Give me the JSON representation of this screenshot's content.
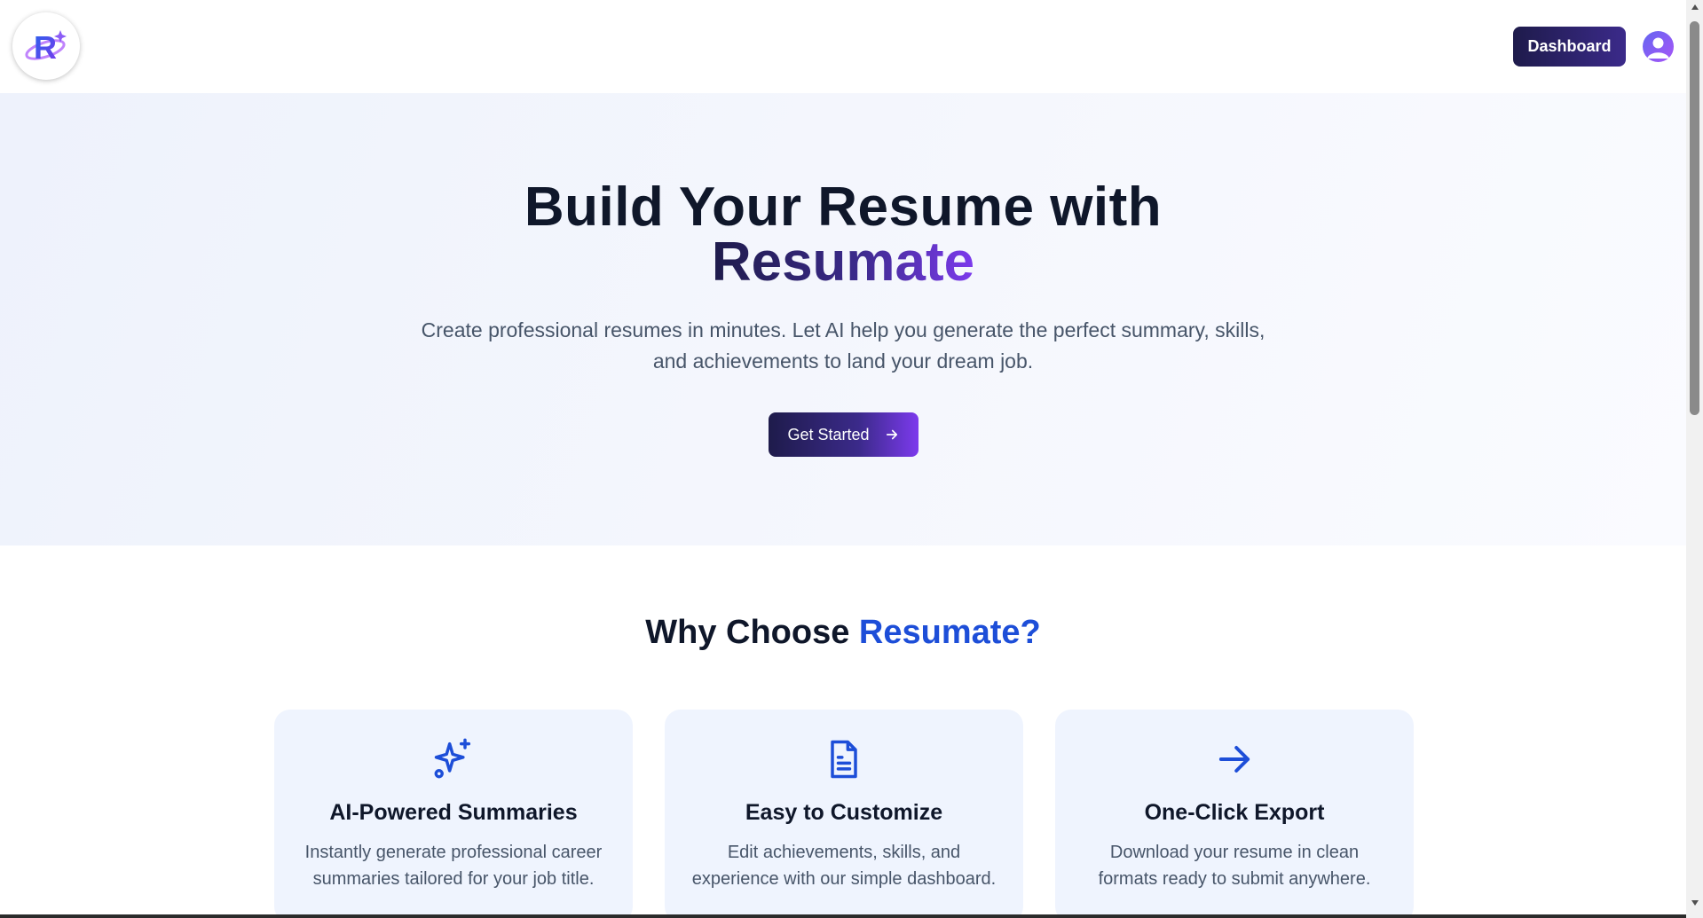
{
  "header": {
    "logo_letter": "R",
    "dashboard_label": "Dashboard",
    "avatar_icon": "user-avatar-icon"
  },
  "hero": {
    "title": "Build Your Resume with",
    "brand": "Resumate",
    "subtitle": "Create professional resumes in minutes. Let AI help you generate the perfect summary, skills, and achievements to land your dream job.",
    "cta_label": "Get Started",
    "cta_icon": "arrow-right-icon"
  },
  "why": {
    "title_prefix": "Why Choose",
    "title_accent": "Resumate?"
  },
  "features": [
    {
      "icon": "sparkles-icon",
      "title": "AI-Powered Summaries",
      "description": "Instantly generate professional career summaries tailored for your job title."
    },
    {
      "icon": "document-icon",
      "title": "Easy to Customize",
      "description": "Edit achievements, skills, and experience with our simple dashboard."
    },
    {
      "icon": "arrow-right-icon",
      "title": "One-Click Export",
      "description": "Download your resume in clean formats ready to submit anywhere."
    }
  ],
  "colors": {
    "primary_dark": "#1e1b4b",
    "primary_purple": "#7c3aed",
    "accent_blue": "#1d4ed8",
    "card_bg": "#eff4fe"
  }
}
